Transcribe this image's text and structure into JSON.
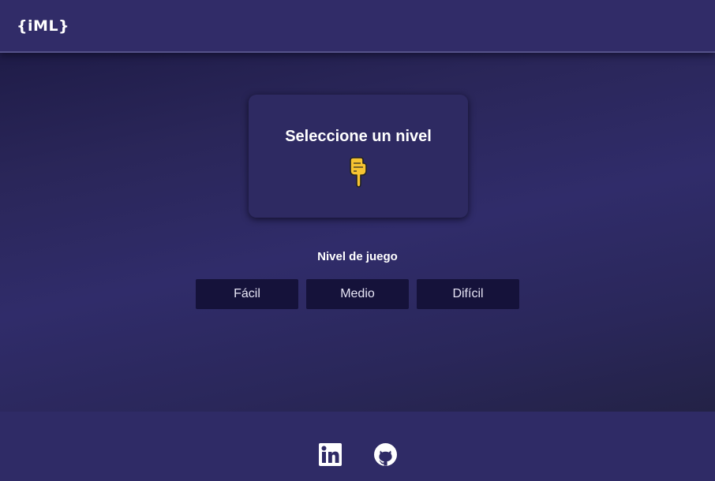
{
  "header": {
    "logo_text": "{iML}"
  },
  "card": {
    "title": "Seleccione un nivel",
    "icon": "pointing-hand-down-icon"
  },
  "levels": {
    "label": "Nivel de juego",
    "options": [
      "Fácil",
      "Medio",
      "Difícil"
    ]
  },
  "footer": {
    "links": [
      {
        "icon": "linkedin-icon"
      },
      {
        "icon": "github-icon"
      }
    ]
  },
  "colors": {
    "header_bg": "#312c68",
    "main_bg": "#2d2a63",
    "card_bg": "#2e2a62",
    "button_bg": "#15123a",
    "footer_bg": "#2f2b66",
    "hand": "#f6c331"
  }
}
